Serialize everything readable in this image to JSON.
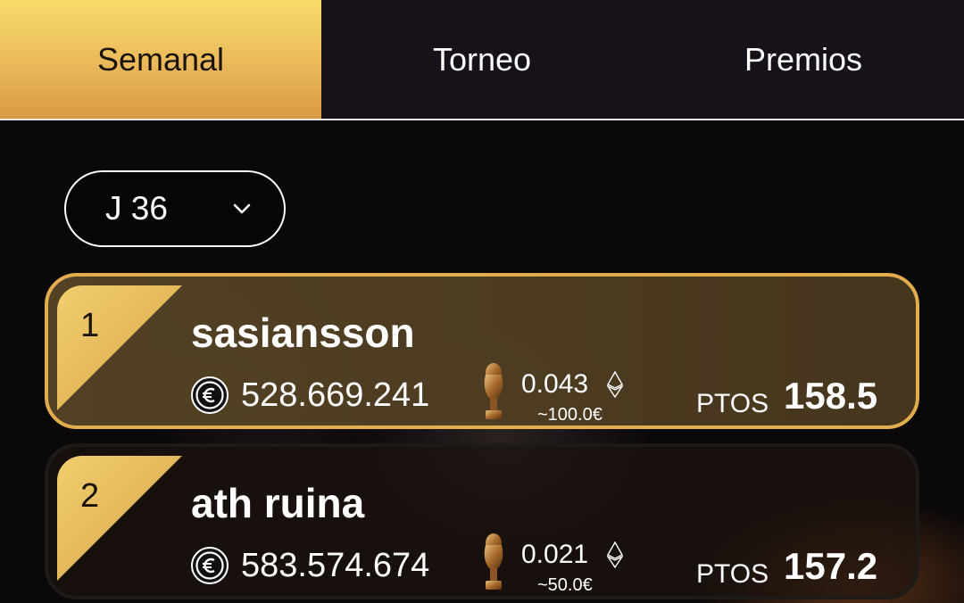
{
  "tabs": [
    {
      "label": "Semanal",
      "active": true
    },
    {
      "label": "Torneo",
      "active": false
    },
    {
      "label": "Premios",
      "active": false
    }
  ],
  "round_selector": {
    "value": "J 36",
    "icon": "chevron-down-icon"
  },
  "leaderboard": [
    {
      "rank": "1",
      "name": "sasiansson",
      "coins": "528.669.241",
      "eth": "0.043",
      "eur": "~100.0€",
      "pts_label": "PTOS",
      "pts": "158.5"
    },
    {
      "rank": "2",
      "name": "ath ruina",
      "coins": "583.574.674",
      "eth": "0.021",
      "eur": "~50.0€",
      "pts_label": "PTOS",
      "pts": "157.2"
    }
  ],
  "icons": {
    "coin": "euro-coin-icon",
    "trophy": "trophy-icon",
    "eth": "ethereum-icon"
  },
  "colors": {
    "gold": "#e2ad4c",
    "tab_active_top": "#f7dc6a",
    "tab_active_bottom": "#d99a44",
    "background": "#0a0708"
  }
}
